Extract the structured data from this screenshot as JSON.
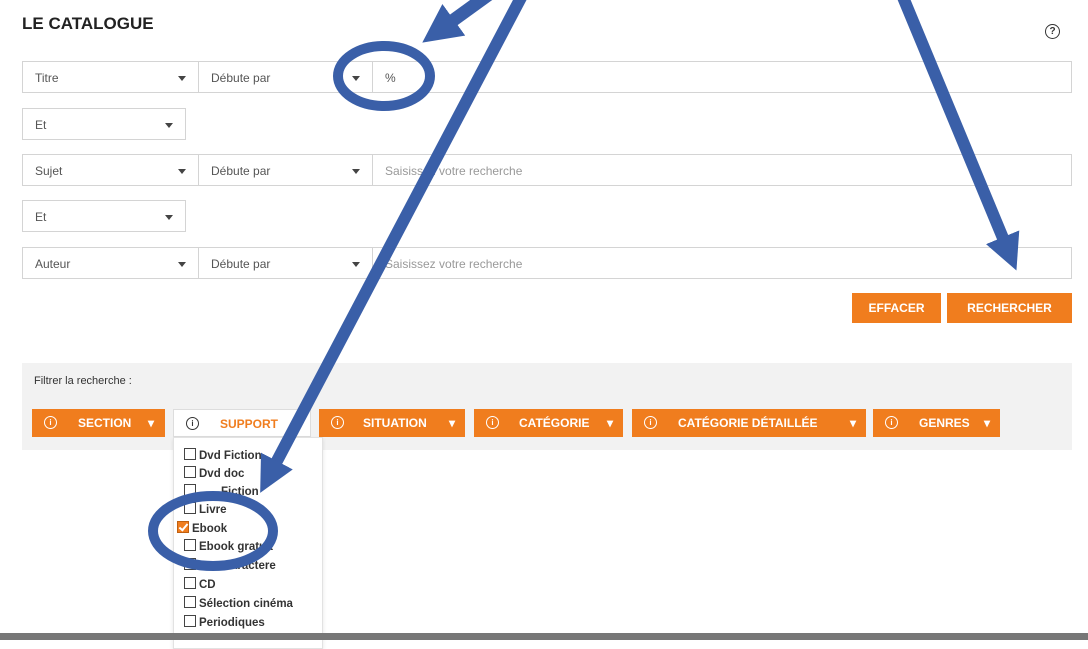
{
  "header": {
    "title": "LE CATALOGUE",
    "help_icon": "?"
  },
  "rows": [
    {
      "field": "Titre",
      "op": "Débute par",
      "value": "%",
      "placeholder": ""
    },
    {
      "conj": "Et"
    },
    {
      "field": "Sujet",
      "op": "Débute par",
      "value": "",
      "placeholder": "Saisissez votre recherche"
    },
    {
      "conj": "Et"
    },
    {
      "field": "Auteur",
      "op": "Débute par",
      "value": "",
      "placeholder": "Saisissez votre recherche"
    }
  ],
  "actions": {
    "clear": "EFFACER",
    "search": "RECHERCHER"
  },
  "filters": {
    "label": "Filtrer la recherche :",
    "info_icon": "i",
    "facets": [
      "SECTION",
      "SUPPORT",
      "SITUATION",
      "CATÉGORIE",
      "CATÉGORIE DÉTAILLÉE",
      "GENRES"
    ],
    "support_options": [
      {
        "label": "Dvd Fiction",
        "checked": false
      },
      {
        "label": "Dvd doc",
        "checked": false
      },
      {
        "label": "Fiction",
        "checked": false
      },
      {
        "label": "Livre",
        "checked": false
      },
      {
        "label": "Ebook",
        "checked": true
      },
      {
        "label": "Ebook gratuit",
        "checked": false
      },
      {
        "label": "s caractere",
        "checked": false
      },
      {
        "label": "CD",
        "checked": false
      },
      {
        "label": "Sélection cinéma",
        "checked": false
      },
      {
        "label": "Periodiques",
        "checked": false
      }
    ]
  },
  "colors": {
    "accent": "#f07d1e",
    "annotation": "#3a5fa8"
  }
}
